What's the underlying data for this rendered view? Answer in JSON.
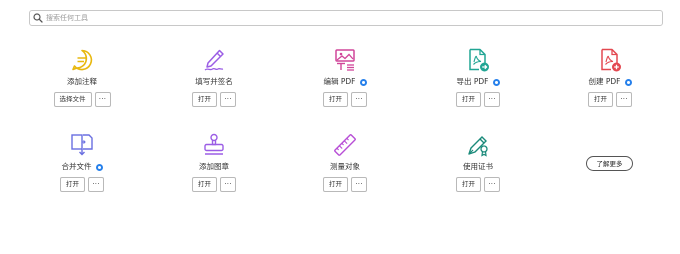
{
  "search": {
    "placeholder": "搜索任何工具"
  },
  "tools": [
    {
      "label": "添加注释",
      "primary_button": "选择文件",
      "more_button": "···",
      "badge": false
    },
    {
      "label": "填写并签名",
      "primary_button": "打开",
      "more_button": "···",
      "badge": false
    },
    {
      "label": "编辑 PDF",
      "primary_button": "打开",
      "more_button": "···",
      "badge": true
    },
    {
      "label": "导出 PDF",
      "primary_button": "打开",
      "more_button": "···",
      "badge": true
    },
    {
      "label": "创建 PDF",
      "primary_button": "打开",
      "more_button": "···",
      "badge": true
    },
    {
      "label": "合并文件",
      "primary_button": "打开",
      "more_button": "···",
      "badge": true
    },
    {
      "label": "添加图章",
      "primary_button": "打开",
      "more_button": "···",
      "badge": false
    },
    {
      "label": "测量对象",
      "primary_button": "打开",
      "more_button": "···",
      "badge": false
    },
    {
      "label": "使用证书",
      "primary_button": "打开",
      "more_button": "···",
      "badge": false
    }
  ],
  "learn_more_label": "了解更多",
  "icons": {
    "search": "search-icon",
    "comment": "comment-icon",
    "fill_sign": "fill-sign-pen-icon",
    "edit_pdf": "edit-pdf-icon",
    "export_pdf": "export-pdf-icon",
    "create_pdf": "create-pdf-icon",
    "combine": "combine-files-icon",
    "stamp": "stamp-icon",
    "measure": "ruler-icon",
    "certificate": "certificate-pen-icon",
    "badge": "info-badge-icon"
  },
  "colors": {
    "comment": "#e8b80f",
    "fill_sign": "#9b5de5",
    "edit_pdf": "#d1469a",
    "export_pdf": "#21a594",
    "create_pdf": "#e34850",
    "combine": "#6a6fe0",
    "stamp": "#9b5de5",
    "measure": "#b84fd6",
    "certificate": "#1a8a7a",
    "badge": "#2680eb"
  }
}
